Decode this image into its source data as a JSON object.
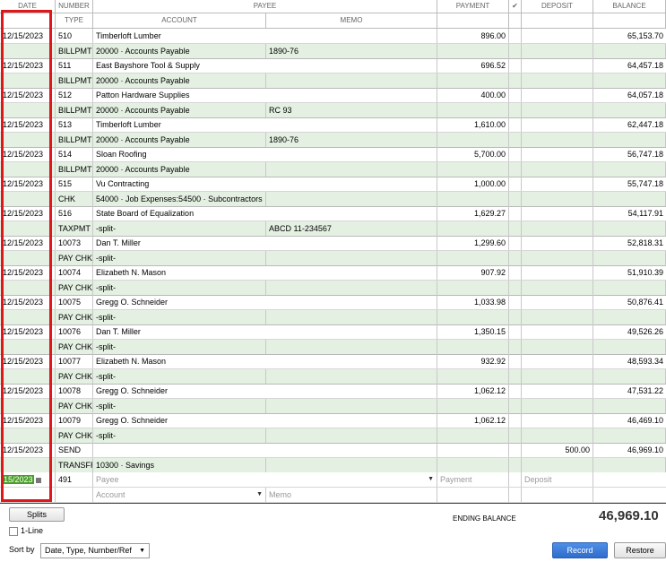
{
  "headers": {
    "date": "DATE",
    "number": "NUMBER",
    "payee": "PAYEE",
    "payment": "PAYMENT",
    "check": "✔",
    "deposit": "DEPOSIT",
    "balance": "BALANCE",
    "type": "TYPE",
    "account": "ACCOUNT",
    "memo": "MEMO"
  },
  "transactions": [
    {
      "date": "12/15/2023",
      "number": "510",
      "payee": "Timberloft Lumber",
      "payment": "896.00",
      "deposit": "",
      "balance": "65,153.70",
      "type": "BILLPMT",
      "account": "20000 · Accounts Payable",
      "memo": "1890-76"
    },
    {
      "date": "12/15/2023",
      "number": "511",
      "payee": "East Bayshore Tool & Supply",
      "payment": "696.52",
      "deposit": "",
      "balance": "64,457.18",
      "type": "BILLPMT",
      "account": "20000 · Accounts Payable",
      "memo": ""
    },
    {
      "date": "12/15/2023",
      "number": "512",
      "payee": "Patton Hardware Supplies",
      "payment": "400.00",
      "deposit": "",
      "balance": "64,057.18",
      "type": "BILLPMT",
      "account": "20000 · Accounts Payable",
      "memo": "RC 93"
    },
    {
      "date": "12/15/2023",
      "number": "513",
      "payee": "Timberloft Lumber",
      "payment": "1,610.00",
      "deposit": "",
      "balance": "62,447.18",
      "type": "BILLPMT",
      "account": "20000 · Accounts Payable",
      "memo": "1890-76"
    },
    {
      "date": "12/15/2023",
      "number": "514",
      "payee": "Sloan Roofing",
      "payment": "5,700.00",
      "deposit": "",
      "balance": "56,747.18",
      "type": "BILLPMT",
      "account": "20000 · Accounts Payable",
      "memo": ""
    },
    {
      "date": "12/15/2023",
      "number": "515",
      "payee": "Vu Contracting",
      "payment": "1,000.00",
      "deposit": "",
      "balance": "55,747.18",
      "type": "CHK",
      "account": "54000 · Job Expenses:54500 · Subcontractors",
      "memo": ""
    },
    {
      "date": "12/15/2023",
      "number": "516",
      "payee": "State Board of Equalization",
      "payment": "1,629.27",
      "deposit": "",
      "balance": "54,117.91",
      "type": "TAXPMT",
      "account": "-split-",
      "memo": "ABCD 11-234567"
    },
    {
      "date": "12/15/2023",
      "number": "10073",
      "payee": "Dan T. Miller",
      "payment": "1,299.60",
      "deposit": "",
      "balance": "52,818.31",
      "type": "PAY CHK",
      "account": "-split-",
      "memo": ""
    },
    {
      "date": "12/15/2023",
      "number": "10074",
      "payee": "Elizabeth N. Mason",
      "payment": "907.92",
      "deposit": "",
      "balance": "51,910.39",
      "type": "PAY CHK",
      "account": "-split-",
      "memo": ""
    },
    {
      "date": "12/15/2023",
      "number": "10075",
      "payee": "Gregg O. Schneider",
      "payment": "1,033.98",
      "deposit": "",
      "balance": "50,876.41",
      "type": "PAY CHK",
      "account": "-split-",
      "memo": ""
    },
    {
      "date": "12/15/2023",
      "number": "10076",
      "payee": "Dan T. Miller",
      "payment": "1,350.15",
      "deposit": "",
      "balance": "49,526.26",
      "type": "PAY CHK",
      "account": "-split-",
      "memo": ""
    },
    {
      "date": "12/15/2023",
      "number": "10077",
      "payee": "Elizabeth N. Mason",
      "payment": "932.92",
      "deposit": "",
      "balance": "48,593.34",
      "type": "PAY CHK",
      "account": "-split-",
      "memo": ""
    },
    {
      "date": "12/15/2023",
      "number": "10078",
      "payee": "Gregg O. Schneider",
      "payment": "1,062.12",
      "deposit": "",
      "balance": "47,531.22",
      "type": "PAY CHK",
      "account": "-split-",
      "memo": ""
    },
    {
      "date": "12/15/2023",
      "number": "10079",
      "payee": "Gregg O. Schneider",
      "payment": "1,062.12",
      "deposit": "",
      "balance": "46,469.10",
      "type": "PAY CHK",
      "account": "-split-",
      "memo": ""
    },
    {
      "date": "12/15/2023",
      "number": "SEND",
      "payee": "",
      "payment": "",
      "deposit": "500.00",
      "balance": "46,969.10",
      "type": "TRANSFR",
      "account": "10300 · Savings",
      "memo": ""
    }
  ],
  "entry": {
    "date": "15/2023",
    "number": "491",
    "payee_placeholder": "Payee",
    "payment_placeholder": "Payment",
    "deposit_placeholder": "Deposit",
    "account_placeholder": "Account",
    "memo_placeholder": "Memo"
  },
  "footer": {
    "splits_label": "Splits",
    "one_line_label": "1-Line",
    "sort_by_label": "Sort by",
    "sort_value": "Date, Type, Number/Ref",
    "ending_balance_label": "ENDING BALANCE",
    "ending_balance_value": "46,969.10",
    "record_label": "Record",
    "restore_label": "Restore"
  },
  "colors": {
    "alt_row": "#e4f1e2",
    "highlight_box": "#e0161b",
    "record_button": "#3a78d8"
  }
}
